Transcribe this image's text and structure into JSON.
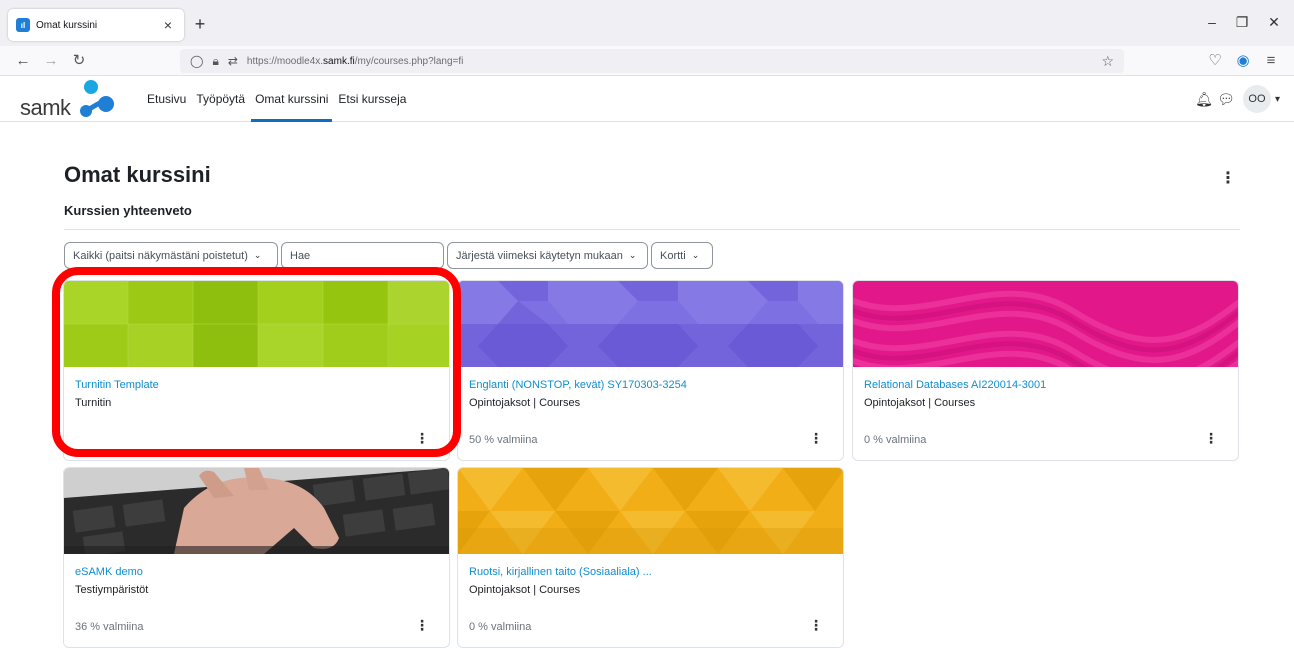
{
  "browser": {
    "tab_title": "Omat kurssini",
    "tab_icon": "moodle-favicon",
    "url_prefix": "https://moodle4x.",
    "url_domain": "samk.fi",
    "url_path": "/my/courses.php?lang=fi"
  },
  "header": {
    "logo_text": "samk",
    "nav": [
      {
        "label": "Etusivu",
        "active": false
      },
      {
        "label": "Työpöytä",
        "active": false
      },
      {
        "label": "Omat kurssini",
        "active": true
      },
      {
        "label": "Etsi kursseja",
        "active": false
      }
    ],
    "user_initials": "OO"
  },
  "page": {
    "title": "Omat kurssini",
    "block_title": "Kurssien yhteenveto"
  },
  "filters": {
    "grouping": "Kaikki (paitsi näkymästäni poistetut)",
    "search_placeholder": "Hae",
    "sort": "Järjestä viimeksi käytetyn mukaan",
    "view": "Kortti"
  },
  "courses": [
    {
      "name": "Turnitin Template",
      "category": "Turnitin",
      "progress": "",
      "image": "green-tiles",
      "color": "#a3cf1a"
    },
    {
      "name": "Englanti (NONSTOP, kevät) SY170303-3254",
      "category": "Opintojaksot | Courses",
      "progress": "50 % valmiina",
      "image": "purple-octagons",
      "color": "#7b6fe0"
    },
    {
      "name": "Relational Databases AI220014-3001",
      "category": "Opintojaksot | Courses",
      "progress": "0 % valmiina",
      "image": "pink-waves",
      "color": "#e8208e"
    },
    {
      "name": "eSAMK demo",
      "category": "Testiympäristöt",
      "progress": "36 % valmiina",
      "image": "keyboard-photo",
      "color": "#555555"
    },
    {
      "name": "Ruotsi, kirjallinen taito (Sosiaaliala) ...",
      "category": "Opintojaksot | Courses",
      "progress": "0 % valmiina",
      "image": "yellow-triangles",
      "color": "#f3b31c"
    }
  ],
  "colors": {
    "accent": "#0f6cbf",
    "link": "#0f8ecf",
    "highlight": "#ff0000"
  }
}
